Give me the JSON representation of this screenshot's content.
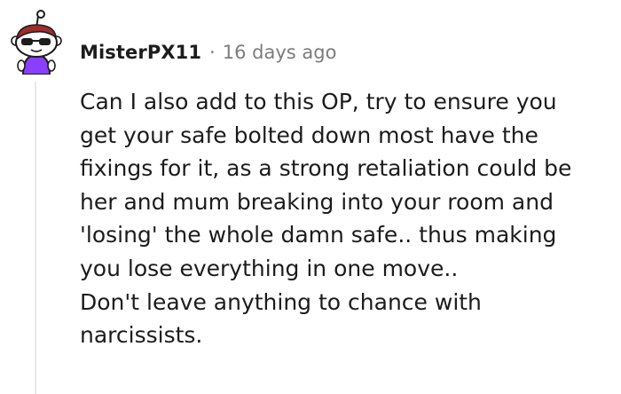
{
  "comment": {
    "username": "MisterPX11",
    "separator": "·",
    "timestamp": "16 days ago",
    "body_lines": [
      "Can I also add to this OP, try to ensure you",
      "get your safe bolted down most have the",
      "fixings for it, as a strong retaliation could be",
      "her and mum breaking into your room and",
      "'losing' the whole damn safe.. thus making",
      "you lose everything in one move..",
      "Don't leave anything to chance with",
      "narcissists."
    ]
  },
  "colors": {
    "text": "#1c1c1c",
    "meta": "#7c7c7c",
    "thread_line": "#e6e9ec",
    "avatar_shirt": "#8a3ffc",
    "avatar_hair": "#9c2d2d"
  },
  "icons": {
    "avatar": "snoo-avatar-icon"
  }
}
